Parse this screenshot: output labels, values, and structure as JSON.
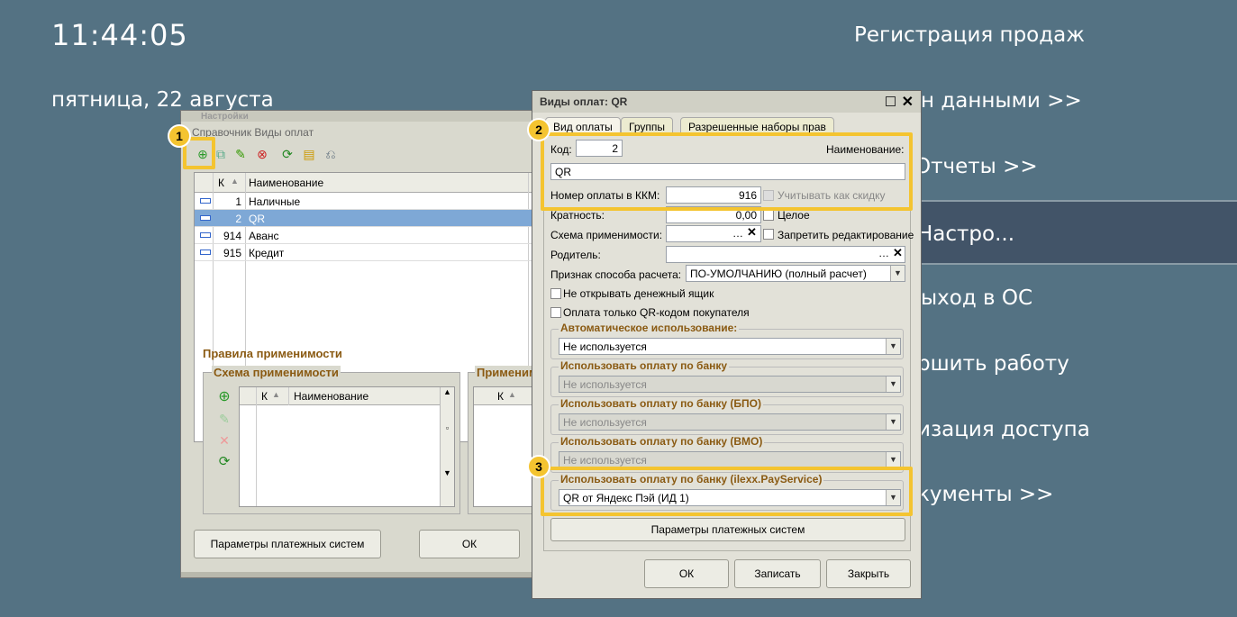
{
  "background": {
    "time": "11:44:05",
    "date": "пятница, 22 августа",
    "header": "Регистрация продаж",
    "menu": [
      "н данными >>",
      "Отчеты >>",
      "Настро...",
      "ыход в ОС",
      "ршить работу",
      "изация доступа",
      "кументы >>"
    ]
  },
  "window1": {
    "title_top": "Настройки",
    "title": "Справочник Виды оплат",
    "columns": {
      "code": "К",
      "name": "Наименование"
    },
    "rows": [
      {
        "code": "1",
        "name": "Наличные"
      },
      {
        "code": "2",
        "name": "QR"
      },
      {
        "code": "914",
        "name": "Аванс"
      },
      {
        "code": "915",
        "name": "Кредит"
      }
    ],
    "rules_title": "Правила применимости",
    "scheme_title": "Схема применимости",
    "scheme2_title": "Применим",
    "scheme_columns": {
      "code": "К",
      "name": "Наименование"
    },
    "btn_params": "Параметры платежных систем",
    "btn_ok": "ОК"
  },
  "window2": {
    "title": "Виды оплат: QR",
    "tabs": [
      "Вид оплаты",
      "Группы",
      "Разрешенные наборы прав"
    ],
    "code_label": "Код:",
    "code_value": "2",
    "name_label": "Наименование:",
    "name_value": "QR",
    "kkm_label": "Номер оплаты в ККМ:",
    "kkm_value": "916",
    "discount_label": "Учитывать как скидку",
    "multiplicity_label": "Кратность:",
    "multiplicity_value": "0,00",
    "integer_label": "Целое",
    "scheme_label": "Схема применимости:",
    "forbid_label": "Запретить редактирование",
    "parent_label": "Родитель:",
    "calc_label": "Признак способа расчета:",
    "calc_value": "ПО-УМОЛЧАНИЮ (полный расчет)",
    "no_drawer_label": "Не открывать денежный ящик",
    "qr_only_label": "Оплата только QR-кодом покупателя",
    "auto_title": "Автоматическое использование:",
    "auto_value": "Не используется",
    "bank_title": "Использовать оплату по банку",
    "bank_value": "Не используется",
    "bpo_title": "Использовать оплату по банку (БПО)",
    "bpo_value": "Не используется",
    "vmo_title": "Использовать оплату по банку (ВМО)",
    "vmo_value": "Не используется",
    "ilexx_title": "Использовать оплату по банку (ilexx.PayService)",
    "ilexx_value": "QR от Яндекс Пэй (ИД 1)",
    "btn_params": "Параметры платежных систем",
    "btn_ok": "ОК",
    "btn_save": "Записать",
    "btn_close": "Закрыть"
  },
  "badges": [
    "1",
    "2",
    "3"
  ],
  "colors": {
    "highlight": "#f4c430",
    "background": "#547283",
    "selection": "#7ea8d6"
  }
}
